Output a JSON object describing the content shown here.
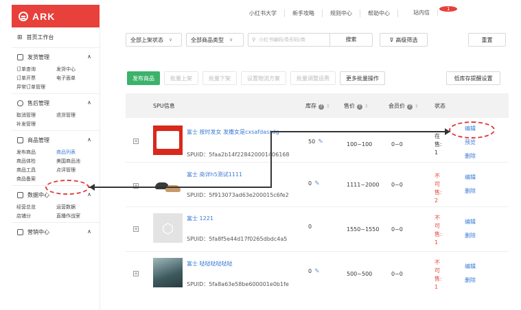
{
  "brand": {
    "name": "ARK"
  },
  "topnav": [
    "小红书大学",
    "新手攻略",
    "规则中心",
    "帮助中心",
    "站内信"
  ],
  "inbox_badge": "1",
  "sidebar": {
    "home": "首页工作台",
    "groups": [
      {
        "title": "发货管理",
        "items": [
          "订单查询",
          "发货中心",
          "订单开票",
          "电子面单",
          "异常订单管理"
        ]
      },
      {
        "title": "售后管理",
        "items": [
          "取消管理",
          "退货管理",
          "补发管理"
        ]
      },
      {
        "title": "商品管理",
        "items": [
          "发布商品",
          "商品列表",
          "商品体检",
          "美国商品池",
          "商品工具",
          "点评管理",
          "商品备案"
        ]
      },
      {
        "title": "数据中心",
        "items": [
          "经营总览",
          "运营数据",
          "店铺分",
          "直播作战室"
        ]
      },
      {
        "title": "营销中心",
        "items": []
      }
    ]
  },
  "filters": {
    "status_select": "全部上架状态",
    "type_select": "全部商品类型",
    "search_placeholder": "小红书编码/条形码/商",
    "search_button": "搜索",
    "advanced_filter": "高级筛选",
    "reset": "重置"
  },
  "actions": {
    "publish": "发布商品",
    "batch_on": "批量上架",
    "batch_off": "批量下架",
    "logistics": "设置物流方案",
    "freight": "批量调整运费",
    "more": "更多批量操作",
    "low_stock": "低库存提醒设置"
  },
  "table": {
    "headers": {
      "spu": "SPU信息",
      "stock": "库存",
      "price": "售价",
      "member_price": "会员价",
      "status": "状态"
    },
    "rows": [
      {
        "title": "富士 按时发女 发撒女是cxsafdassdg",
        "spuid": "SPUID：5faa2b14f228420001406168",
        "stock": "50",
        "price": "100~100",
        "member_price": "0~0",
        "status": [
          "在",
          "售:",
          "1"
        ],
        "status_red": false,
        "ops": [
          "编辑",
          "预览",
          "删除"
        ],
        "thumb_color": "#d9281c"
      },
      {
        "title": "富士 商详h5测试1111",
        "spuid": "SPUID：5f913073ad63e200015c6fe2",
        "stock": "0",
        "price": "1111~2000",
        "member_price": "0~0",
        "status": [
          "不可",
          "售:",
          "2"
        ],
        "status_red": true,
        "ops": [
          "编辑",
          "删除"
        ],
        "thumb_color": "#ffffff"
      },
      {
        "title": "富士 1221",
        "spuid": "SPUID：5fa8f5e44d17f0265dbdc4a5",
        "stock": "0",
        "price": "1550~1550",
        "member_price": "0~0",
        "status": [
          "不可",
          "售:",
          "1"
        ],
        "status_red": true,
        "ops": [
          "编辑",
          "删除"
        ],
        "thumb_color": "#e3e3e3"
      },
      {
        "title": "富士 哒哒哒哒哒哒",
        "spuid": "SPUID：5fa8a63e58be600001e0b1fe",
        "stock": "0",
        "price": "500~500",
        "member_price": "0~0",
        "status": [
          "不可",
          "售:",
          "1"
        ],
        "status_red": true,
        "ops": [
          "编辑",
          "删除"
        ],
        "thumb_color": "#4d6a70"
      }
    ]
  },
  "colors": {
    "brand_red": "#e8403a",
    "primary_green": "#3cb26b",
    "link_blue": "#3a7bd5",
    "annotation_red": "#e03a3a"
  }
}
